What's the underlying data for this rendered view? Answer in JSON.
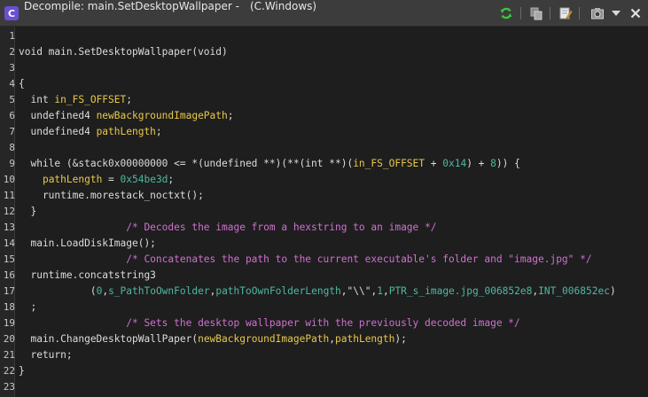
{
  "window": {
    "title_prefix": "Decompile: main.SetDesktopWallpaper -",
    "title_suffix": "(C.Windows)",
    "app_icon_glyph": "C",
    "icons": [
      "refresh-icon",
      "copy-icon",
      "edit-icon",
      "snapshot-icon",
      "menu-chevron-icon",
      "close-icon"
    ]
  },
  "code": {
    "lines": [
      {
        "num": "1",
        "tokens": []
      },
      {
        "num": "2",
        "tokens": [
          {
            "t": "void main.SetDesktopWallpaper(void)",
            "c": "fn"
          }
        ]
      },
      {
        "num": "3",
        "tokens": []
      },
      {
        "num": "4",
        "tokens": [
          {
            "t": "{",
            "c": "default"
          }
        ]
      },
      {
        "num": "5",
        "tokens": [
          {
            "t": "  int ",
            "c": "type"
          },
          {
            "t": "in_FS_OFFSET",
            "c": "var"
          },
          {
            "t": ";",
            "c": "default"
          }
        ]
      },
      {
        "num": "6",
        "tokens": [
          {
            "t": "  undefined4 ",
            "c": "type"
          },
          {
            "t": "newBackgroundImagePath",
            "c": "var"
          },
          {
            "t": ";",
            "c": "default"
          }
        ]
      },
      {
        "num": "7",
        "tokens": [
          {
            "t": "  undefined4 ",
            "c": "type"
          },
          {
            "t": "pathLength",
            "c": "var"
          },
          {
            "t": ";",
            "c": "default"
          }
        ]
      },
      {
        "num": "8",
        "tokens": []
      },
      {
        "num": "9",
        "tokens": [
          {
            "t": "  while (&stack0x00000000 <= *(undefined **)(**(int **)(",
            "c": "default"
          },
          {
            "t": "in_FS_OFFSET",
            "c": "var"
          },
          {
            "t": " + ",
            "c": "default"
          },
          {
            "t": "0x14",
            "c": "num"
          },
          {
            "t": ") + ",
            "c": "default"
          },
          {
            "t": "8",
            "c": "num"
          },
          {
            "t": ")) {",
            "c": "default"
          }
        ]
      },
      {
        "num": "10",
        "tokens": [
          {
            "t": "    ",
            "c": "default"
          },
          {
            "t": "pathLength",
            "c": "var"
          },
          {
            "t": " = ",
            "c": "default"
          },
          {
            "t": "0x54be3d",
            "c": "num"
          },
          {
            "t": ";",
            "c": "default"
          }
        ]
      },
      {
        "num": "11",
        "tokens": [
          {
            "t": "    runtime.morestack_noctxt();",
            "c": "fn"
          }
        ]
      },
      {
        "num": "12",
        "tokens": [
          {
            "t": "  }",
            "c": "default"
          }
        ]
      },
      {
        "num": "13",
        "tokens": [
          {
            "t": "                  /* Decodes the image from a hexstring to an image */",
            "c": "cmt"
          }
        ]
      },
      {
        "num": "14",
        "tokens": [
          {
            "t": "  main.LoadDiskImage();",
            "c": "fn"
          }
        ]
      },
      {
        "num": "15",
        "tokens": [
          {
            "t": "                  /* Concatenates the path to the current executable's folder and \"image.jpg\" */",
            "c": "cmt"
          }
        ]
      },
      {
        "num": "16",
        "tokens": [
          {
            "t": "  runtime.concatstring3",
            "c": "fn"
          }
        ]
      },
      {
        "num": "17",
        "tokens": [
          {
            "t": "            (",
            "c": "default"
          },
          {
            "t": "0",
            "c": "num"
          },
          {
            "t": ",",
            "c": "default"
          },
          {
            "t": "s_PathToOwnFolder",
            "c": "glob"
          },
          {
            "t": ",",
            "c": "default"
          },
          {
            "t": "pathToOwnFolderLength",
            "c": "glob"
          },
          {
            "t": ",\"\\\\\",",
            "c": "str"
          },
          {
            "t": "1",
            "c": "num"
          },
          {
            "t": ",",
            "c": "default"
          },
          {
            "t": "PTR_s_image.jpg_006852e8",
            "c": "glob"
          },
          {
            "t": ",",
            "c": "default"
          },
          {
            "t": "INT_006852ec",
            "c": "glob"
          },
          {
            "t": ")",
            "c": "default"
          }
        ]
      },
      {
        "num": "18",
        "tokens": [
          {
            "t": "  ;",
            "c": "default"
          }
        ]
      },
      {
        "num": "19",
        "tokens": [
          {
            "t": "                  /* Sets the desktop wallpaper with the previously decoded image */",
            "c": "cmt"
          }
        ]
      },
      {
        "num": "20",
        "tokens": [
          {
            "t": "  main.ChangeDesktopWallPaper(",
            "c": "fn"
          },
          {
            "t": "newBackgroundImagePath",
            "c": "var"
          },
          {
            "t": ",",
            "c": "default"
          },
          {
            "t": "pathLength",
            "c": "var"
          },
          {
            "t": ");",
            "c": "default"
          }
        ]
      },
      {
        "num": "21",
        "tokens": [
          {
            "t": "  return;",
            "c": "default"
          }
        ]
      },
      {
        "num": "22",
        "tokens": [
          {
            "t": "}",
            "c": "default"
          }
        ]
      },
      {
        "num": "23",
        "tokens": []
      }
    ]
  }
}
